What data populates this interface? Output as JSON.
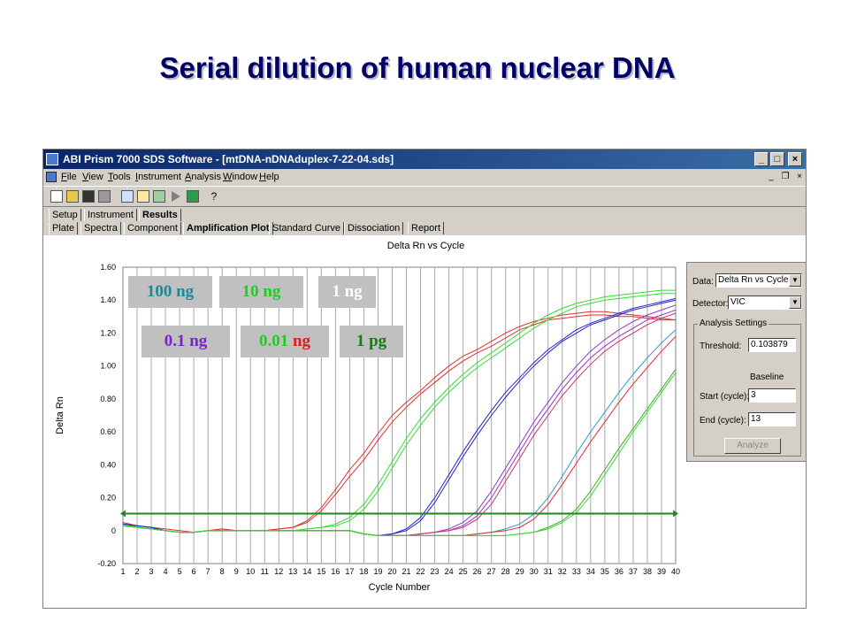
{
  "slide_title": "Serial dilution of human nuclear DNA",
  "window": {
    "title": "ABI Prism 7000 SDS Software - [mtDNA-nDNAduplex-7-22-04.sds]",
    "buttons": [
      "_",
      "□",
      "×"
    ]
  },
  "menu": {
    "items": [
      {
        "accel": "F",
        "rest": "ile"
      },
      {
        "accel": "V",
        "rest": "iew"
      },
      {
        "accel": "T",
        "rest": "ools"
      },
      {
        "accel": "I",
        "rest": "nstrument"
      },
      {
        "accel": "A",
        "rest": "nalysis"
      },
      {
        "accel": "W",
        "rest": "indow"
      },
      {
        "accel": "H",
        "rest": "elp"
      }
    ],
    "mdi_buttons": [
      "_",
      "❐",
      "×"
    ]
  },
  "toolbar": {
    "icons": [
      "new-icon",
      "open-icon",
      "save-icon",
      "print-icon",
      "zoom-icon",
      "edit-icon",
      "sheet-icon",
      "play-icon",
      "run-icon",
      "help-icon"
    ]
  },
  "tabs_top": [
    {
      "label": "Setup",
      "active": false
    },
    {
      "label": "Instrument",
      "active": false
    },
    {
      "label": "Results",
      "active": true
    }
  ],
  "tabs_sub": [
    {
      "label": "Plate",
      "active": false
    },
    {
      "label": "Spectra",
      "active": false
    },
    {
      "label": "Component",
      "active": false
    },
    {
      "label": "Amplification Plot",
      "active": true
    },
    {
      "label": "Standard Curve",
      "active": false
    },
    {
      "label": "Dissociation",
      "active": false
    },
    {
      "label": "Report",
      "active": false
    }
  ],
  "settings": {
    "data_label": "Data:",
    "data_value": "Delta Rn vs Cycle",
    "detector_label": "Detector:",
    "detector_value": "VIC",
    "group_title": "Analysis Settings",
    "threshold_label": "Threshold:",
    "threshold_value": "0.103879",
    "baseline_label": "Baseline",
    "start_label": "Start (cycle):",
    "start_value": "3",
    "end_label": "End (cycle):",
    "end_value": "13",
    "analyze_label": "Analyze"
  },
  "dilution_labels": [
    {
      "parts": [
        {
          "text": "100 ng",
          "color": "#1a8a9a"
        }
      ]
    },
    {
      "parts": [
        {
          "text": "10 ng",
          "color": "#22cc22"
        }
      ]
    },
    {
      "parts": [
        {
          "text": "1 ng",
          "color": "#ffffff"
        }
      ]
    },
    {
      "parts": [
        {
          "text": "0.1 ng",
          "color": "#7a22cc"
        }
      ]
    },
    {
      "parts": [
        {
          "text": "0.01 ",
          "color": "#22cc22"
        },
        {
          "text": "ng",
          "color": "#d42020"
        }
      ]
    },
    {
      "parts": [
        {
          "text": "1 pg",
          "color": "#1a7a1a"
        }
      ]
    }
  ],
  "chart_data": {
    "type": "line",
    "title": "Delta Rn vs Cycle",
    "xlabel": "Cycle Number",
    "ylabel": "Delta Rn",
    "xlim": [
      1,
      40
    ],
    "ylim": [
      -0.2,
      1.6
    ],
    "x_ticks": [
      1,
      2,
      3,
      4,
      5,
      6,
      7,
      8,
      9,
      10,
      11,
      12,
      13,
      14,
      15,
      16,
      17,
      18,
      19,
      20,
      21,
      22,
      23,
      24,
      25,
      26,
      27,
      28,
      29,
      30,
      31,
      32,
      33,
      34,
      35,
      36,
      37,
      38,
      39,
      40
    ],
    "y_tick_labels": [
      "1.60",
      "1.40",
      "1.20",
      "1.00",
      "0.80",
      "0.60",
      "0.40",
      "0.20",
      "0",
      "-0.20"
    ],
    "y_tick_values": [
      1.6,
      1.4,
      1.2,
      1.0,
      0.8,
      0.6,
      0.4,
      0.2,
      0,
      -0.2
    ],
    "threshold": 0.103879,
    "threshold_color": "#1a8a1a",
    "grid": "vertical",
    "series": [
      {
        "color": "#e03030",
        "values": [
          0.04,
          0.03,
          0.02,
          0.01,
          0.0,
          -0.01,
          0.0,
          0.01,
          0.0,
          0.0,
          0.0,
          0.01,
          0.02,
          0.06,
          0.14,
          0.25,
          0.37,
          0.47,
          0.59,
          0.7,
          0.78,
          0.85,
          0.93,
          1.0,
          1.06,
          1.1,
          1.15,
          1.2,
          1.24,
          1.27,
          1.29,
          1.31,
          1.32,
          1.33,
          1.33,
          1.32,
          1.31,
          1.3,
          1.29,
          1.28
        ]
      },
      {
        "color": "#e03030",
        "values": [
          0.05,
          0.03,
          0.02,
          0.0,
          -0.01,
          -0.01,
          0.0,
          0.01,
          0.0,
          0.0,
          0.0,
          0.01,
          0.02,
          0.05,
          0.12,
          0.22,
          0.33,
          0.43,
          0.55,
          0.66,
          0.75,
          0.83,
          0.9,
          0.97,
          1.03,
          1.08,
          1.12,
          1.17,
          1.22,
          1.25,
          1.28,
          1.29,
          1.3,
          1.31,
          1.31,
          1.3,
          1.3,
          1.29,
          1.28,
          1.28
        ]
      },
      {
        "color": "#33dd33",
        "values": [
          0.03,
          0.03,
          0.02,
          0.0,
          -0.01,
          -0.01,
          0.0,
          0.0,
          0.0,
          0.0,
          0.0,
          0.0,
          0.0,
          0.01,
          0.02,
          0.04,
          0.08,
          0.16,
          0.28,
          0.42,
          0.56,
          0.68,
          0.78,
          0.87,
          0.95,
          1.02,
          1.08,
          1.14,
          1.2,
          1.26,
          1.31,
          1.35,
          1.38,
          1.4,
          1.42,
          1.43,
          1.44,
          1.45,
          1.46,
          1.46
        ]
      },
      {
        "color": "#33dd33",
        "values": [
          0.03,
          0.03,
          0.02,
          0.0,
          -0.01,
          -0.01,
          0.0,
          0.0,
          0.0,
          0.0,
          0.0,
          0.0,
          0.0,
          0.01,
          0.02,
          0.03,
          0.06,
          0.13,
          0.24,
          0.38,
          0.52,
          0.64,
          0.75,
          0.84,
          0.92,
          0.99,
          1.05,
          1.11,
          1.17,
          1.23,
          1.28,
          1.32,
          1.36,
          1.38,
          1.4,
          1.41,
          1.42,
          1.43,
          1.44,
          1.44
        ]
      },
      {
        "color": "#2222cc",
        "values": [
          0.04,
          0.03,
          0.02,
          0.0,
          -0.01,
          -0.01,
          0.0,
          0.0,
          0.0,
          0.0,
          0.0,
          0.0,
          0.0,
          0.0,
          0.0,
          0.0,
          0.0,
          -0.02,
          -0.03,
          -0.02,
          0.01,
          0.08,
          0.2,
          0.34,
          0.48,
          0.61,
          0.73,
          0.84,
          0.93,
          1.02,
          1.1,
          1.16,
          1.22,
          1.26,
          1.29,
          1.32,
          1.35,
          1.37,
          1.39,
          1.41
        ]
      },
      {
        "color": "#2222cc",
        "values": [
          0.04,
          0.03,
          0.02,
          0.0,
          -0.01,
          -0.01,
          0.0,
          0.0,
          0.0,
          0.0,
          0.0,
          0.0,
          0.0,
          0.0,
          0.0,
          0.0,
          0.0,
          -0.02,
          -0.03,
          -0.02,
          0.0,
          0.06,
          0.17,
          0.31,
          0.45,
          0.58,
          0.7,
          0.81,
          0.91,
          1.0,
          1.08,
          1.15,
          1.2,
          1.25,
          1.28,
          1.31,
          1.34,
          1.36,
          1.38,
          1.4
        ]
      },
      {
        "color": "#9933cc",
        "values": [
          0.03,
          0.02,
          0.01,
          0.0,
          -0.01,
          -0.01,
          0.0,
          0.0,
          0.0,
          0.0,
          0.0,
          0.0,
          0.0,
          0.0,
          0.0,
          0.0,
          0.0,
          -0.02,
          -0.03,
          -0.03,
          -0.03,
          -0.02,
          -0.01,
          0.01,
          0.05,
          0.12,
          0.24,
          0.38,
          0.52,
          0.66,
          0.78,
          0.9,
          1.0,
          1.09,
          1.16,
          1.22,
          1.27,
          1.31,
          1.34,
          1.37
        ]
      },
      {
        "color": "#9933cc",
        "values": [
          0.03,
          0.02,
          0.01,
          0.0,
          -0.01,
          -0.01,
          0.0,
          0.0,
          0.0,
          0.0,
          0.0,
          0.0,
          0.0,
          0.0,
          0.0,
          0.0,
          0.0,
          -0.02,
          -0.03,
          -0.03,
          -0.03,
          -0.02,
          -0.01,
          0.0,
          0.03,
          0.09,
          0.2,
          0.34,
          0.48,
          0.62,
          0.74,
          0.86,
          0.96,
          1.05,
          1.12,
          1.18,
          1.23,
          1.28,
          1.31,
          1.34
        ]
      },
      {
        "color": "#d03070",
        "values": [
          0.03,
          0.02,
          0.01,
          0.0,
          -0.01,
          -0.01,
          0.0,
          0.0,
          0.0,
          0.0,
          0.0,
          0.0,
          0.0,
          0.0,
          0.0,
          0.0,
          0.0,
          -0.02,
          -0.03,
          -0.03,
          -0.03,
          -0.02,
          -0.01,
          0.0,
          0.02,
          0.07,
          0.16,
          0.3,
          0.44,
          0.58,
          0.7,
          0.82,
          0.92,
          1.01,
          1.09,
          1.15,
          1.2,
          1.25,
          1.29,
          1.32
        ]
      },
      {
        "color": "#3399cc",
        "values": [
          0.03,
          0.02,
          0.01,
          0.0,
          -0.01,
          -0.01,
          0.0,
          0.0,
          0.0,
          0.0,
          0.0,
          0.0,
          0.0,
          0.0,
          0.0,
          0.0,
          0.0,
          -0.02,
          -0.03,
          -0.03,
          -0.03,
          -0.03,
          -0.03,
          -0.03,
          -0.03,
          -0.02,
          -0.01,
          0.01,
          0.04,
          0.1,
          0.2,
          0.33,
          0.47,
          0.6,
          0.72,
          0.84,
          0.95,
          1.05,
          1.14,
          1.22
        ]
      },
      {
        "color": "#e03030",
        "values": [
          0.03,
          0.02,
          0.01,
          0.0,
          -0.01,
          -0.01,
          0.0,
          0.0,
          0.0,
          0.0,
          0.0,
          0.0,
          0.0,
          0.0,
          0.0,
          0.0,
          0.0,
          -0.02,
          -0.03,
          -0.03,
          -0.03,
          -0.03,
          -0.03,
          -0.03,
          -0.03,
          -0.02,
          -0.01,
          0.0,
          0.02,
          0.07,
          0.16,
          0.28,
          0.41,
          0.54,
          0.66,
          0.78,
          0.89,
          0.99,
          1.09,
          1.18
        ]
      },
      {
        "color": "#44aa22",
        "values": [
          0.03,
          0.02,
          0.01,
          0.0,
          -0.01,
          -0.01,
          0.0,
          0.0,
          0.0,
          0.0,
          0.0,
          0.0,
          0.0,
          0.0,
          0.0,
          0.0,
          0.0,
          -0.02,
          -0.03,
          -0.03,
          -0.03,
          -0.03,
          -0.03,
          -0.03,
          -0.03,
          -0.03,
          -0.03,
          -0.03,
          -0.02,
          -0.01,
          0.02,
          0.06,
          0.13,
          0.24,
          0.37,
          0.5,
          0.62,
          0.74,
          0.86,
          0.98
        ]
      },
      {
        "color": "#33dd33",
        "values": [
          0.03,
          0.02,
          0.01,
          0.0,
          -0.01,
          -0.01,
          0.0,
          0.0,
          0.0,
          0.0,
          0.0,
          0.0,
          0.0,
          0.0,
          0.0,
          0.0,
          0.0,
          -0.02,
          -0.03,
          -0.03,
          -0.03,
          -0.03,
          -0.03,
          -0.03,
          -0.03,
          -0.03,
          -0.03,
          -0.03,
          -0.02,
          -0.01,
          0.01,
          0.05,
          0.11,
          0.21,
          0.34,
          0.47,
          0.6,
          0.72,
          0.84,
          0.96
        ]
      }
    ]
  }
}
